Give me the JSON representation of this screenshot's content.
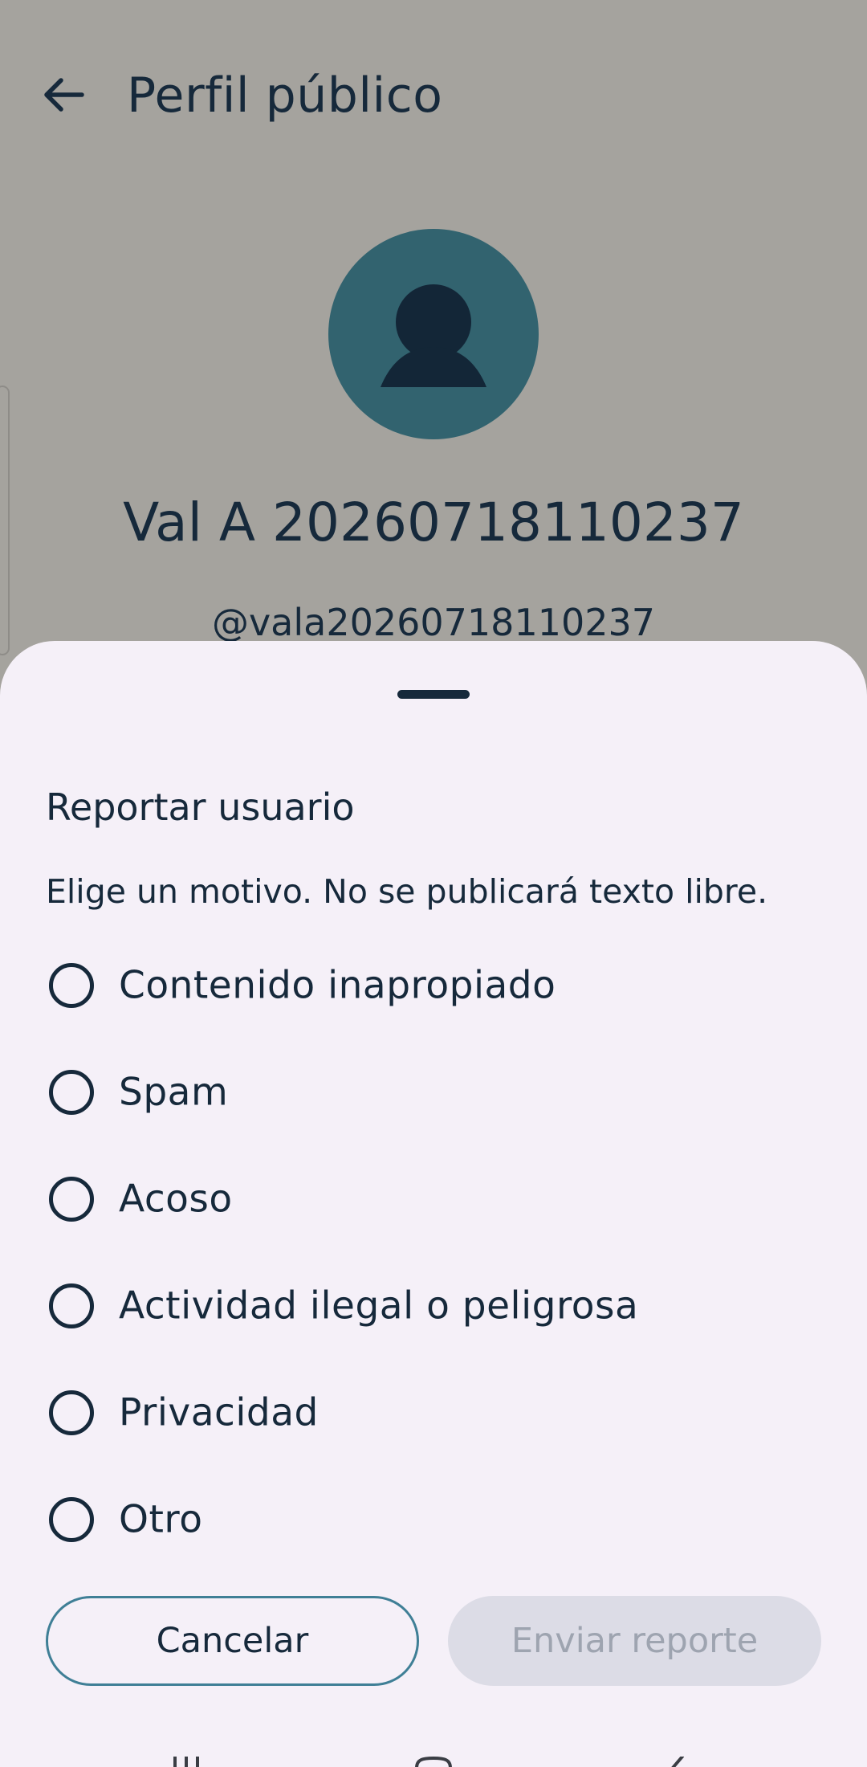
{
  "page": {
    "title": "Perfil público",
    "back_icon": "arrow-left-icon"
  },
  "profile": {
    "avatar_icon": "person-icon",
    "name": "Val A 20260718110237",
    "handle": "@vala20260718110237"
  },
  "sheet": {
    "title": "Reportar usuario",
    "description": "Elige un motivo. No se publicará texto libre.",
    "options": [
      {
        "label": "Contenido inapropiado",
        "selected": false
      },
      {
        "label": "Spam",
        "selected": false
      },
      {
        "label": "Acoso",
        "selected": false
      },
      {
        "label": "Actividad ilegal o peligrosa",
        "selected": false
      },
      {
        "label": "Privacidad",
        "selected": false
      },
      {
        "label": "Otro",
        "selected": false
      }
    ],
    "cancel_label": "Cancelar",
    "submit_label": "Enviar reporte",
    "submit_enabled": false
  },
  "navbar": {
    "icons": [
      "recents-icon",
      "home-icon",
      "back-icon"
    ]
  },
  "colors": {
    "scrim": "#a5a39e",
    "sheet_bg": "#f5f0f8",
    "text": "#16293b",
    "avatar_bg": "#32636f",
    "accent_border": "#3f7f96",
    "disabled_bg": "#dcdce6",
    "disabled_text": "#9ea4b0"
  }
}
